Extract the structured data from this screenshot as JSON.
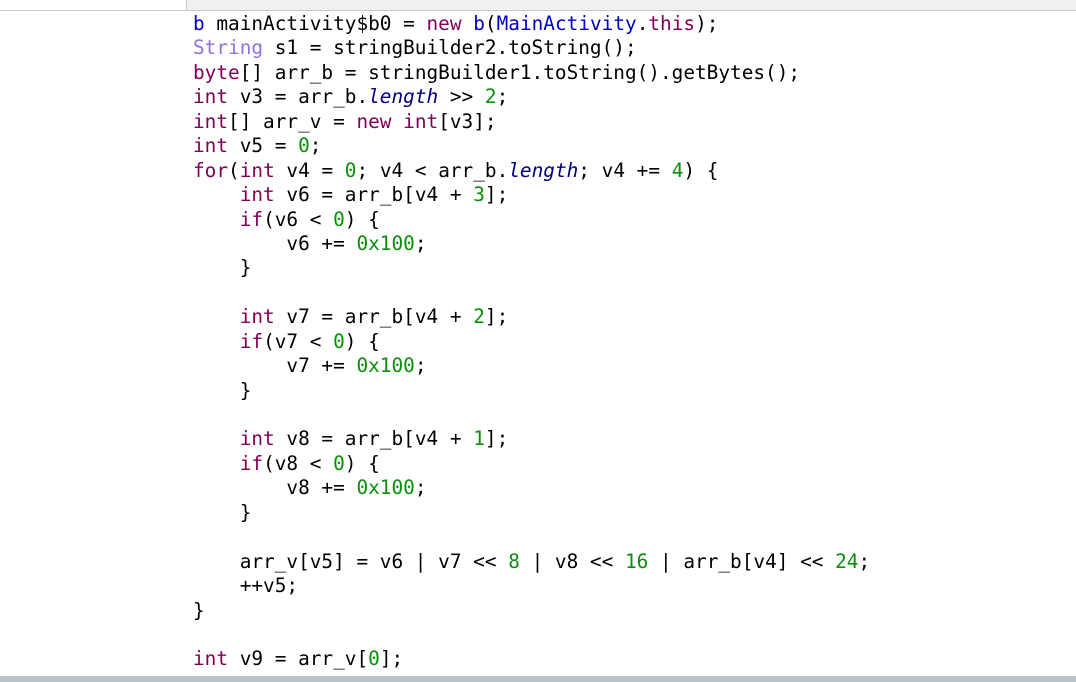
{
  "editor": {
    "lines": [
      [
        [
          "b",
          "ty"
        ],
        [
          " mainActivity$b0 = ",
          ""
        ],
        [
          "new",
          "kw"
        ],
        [
          " ",
          ""
        ],
        [
          "b",
          "ty"
        ],
        [
          "(",
          ""
        ],
        [
          "MainActivity",
          "ty"
        ],
        [
          ".",
          ""
        ],
        [
          "this",
          "kw"
        ],
        [
          ");",
          ""
        ]
      ],
      [
        [
          "String",
          "cls"
        ],
        [
          " s1 = stringBuilder2.toString();",
          ""
        ]
      ],
      [
        [
          "byte",
          "kw"
        ],
        [
          "[] arr_b = stringBuilder1.toString().getBytes();",
          ""
        ]
      ],
      [
        [
          "int",
          "kw"
        ],
        [
          " v3 = arr_b.",
          ""
        ],
        [
          "length",
          "fld"
        ],
        [
          " >> ",
          ""
        ],
        [
          "2",
          "num"
        ],
        [
          ";",
          ""
        ]
      ],
      [
        [
          "int",
          "kw"
        ],
        [
          "[] arr_v = ",
          ""
        ],
        [
          "new",
          "kw"
        ],
        [
          " ",
          ""
        ],
        [
          "int",
          "kw"
        ],
        [
          "[v3];",
          ""
        ]
      ],
      [
        [
          "int",
          "kw"
        ],
        [
          " v5 = ",
          ""
        ],
        [
          "0",
          "num"
        ],
        [
          ";",
          ""
        ]
      ],
      [
        [
          "for",
          "kw"
        ],
        [
          "(",
          ""
        ],
        [
          "int",
          "kw"
        ],
        [
          " v4 = ",
          ""
        ],
        [
          "0",
          "num"
        ],
        [
          "; v4 < arr_b.",
          ""
        ],
        [
          "length",
          "fld"
        ],
        [
          "; v4 += ",
          ""
        ],
        [
          "4",
          "num"
        ],
        [
          ") {",
          ""
        ]
      ],
      [
        [
          "    ",
          ""
        ],
        [
          "int",
          "kw"
        ],
        [
          " v6 = arr_b[v4 + ",
          ""
        ],
        [
          "3",
          "num"
        ],
        [
          "];",
          ""
        ]
      ],
      [
        [
          "    ",
          ""
        ],
        [
          "if",
          "kw"
        ],
        [
          "(v6 < ",
          ""
        ],
        [
          "0",
          "num"
        ],
        [
          ") {",
          ""
        ]
      ],
      [
        [
          "        v6 += ",
          ""
        ],
        [
          "0x100",
          "num"
        ],
        [
          ";",
          ""
        ]
      ],
      [
        [
          "    }",
          ""
        ]
      ],
      [],
      [
        [
          "    ",
          ""
        ],
        [
          "int",
          "kw"
        ],
        [
          " v7 = arr_b[v4 + ",
          ""
        ],
        [
          "2",
          "num"
        ],
        [
          "];",
          ""
        ]
      ],
      [
        [
          "    ",
          ""
        ],
        [
          "if",
          "kw"
        ],
        [
          "(v7 < ",
          ""
        ],
        [
          "0",
          "num"
        ],
        [
          ") {",
          ""
        ]
      ],
      [
        [
          "        v7 += ",
          ""
        ],
        [
          "0x100",
          "num"
        ],
        [
          ";",
          ""
        ]
      ],
      [
        [
          "    }",
          ""
        ]
      ],
      [],
      [
        [
          "    ",
          ""
        ],
        [
          "int",
          "kw"
        ],
        [
          " v8 = arr_b[v4 + ",
          ""
        ],
        [
          "1",
          "num"
        ],
        [
          "];",
          ""
        ]
      ],
      [
        [
          "    ",
          ""
        ],
        [
          "if",
          "kw"
        ],
        [
          "(v8 < ",
          ""
        ],
        [
          "0",
          "num"
        ],
        [
          ") {",
          ""
        ]
      ],
      [
        [
          "        v8 += ",
          ""
        ],
        [
          "0x100",
          "num"
        ],
        [
          ";",
          ""
        ]
      ],
      [
        [
          "    }",
          ""
        ]
      ],
      [],
      [
        [
          "    arr_v[v5] = v6 | v7 << ",
          ""
        ],
        [
          "8",
          "num"
        ],
        [
          " | v8 << ",
          ""
        ],
        [
          "16",
          "num"
        ],
        [
          " | arr_b[v4] << ",
          ""
        ],
        [
          "24",
          "num"
        ],
        [
          ";",
          ""
        ]
      ],
      [
        [
          "    ++v5;",
          ""
        ]
      ],
      [
        [
          "}",
          ""
        ]
      ],
      [],
      [
        [
          "int",
          "kw"
        ],
        [
          " v9 = arr_v[",
          ""
        ],
        [
          "0",
          "num"
        ],
        [
          "];",
          ""
        ]
      ]
    ]
  },
  "colors": {
    "keyword": "#7f0055",
    "type": "#0000c0",
    "class": "#9370db",
    "number": "#098f09",
    "field": "#000080"
  }
}
